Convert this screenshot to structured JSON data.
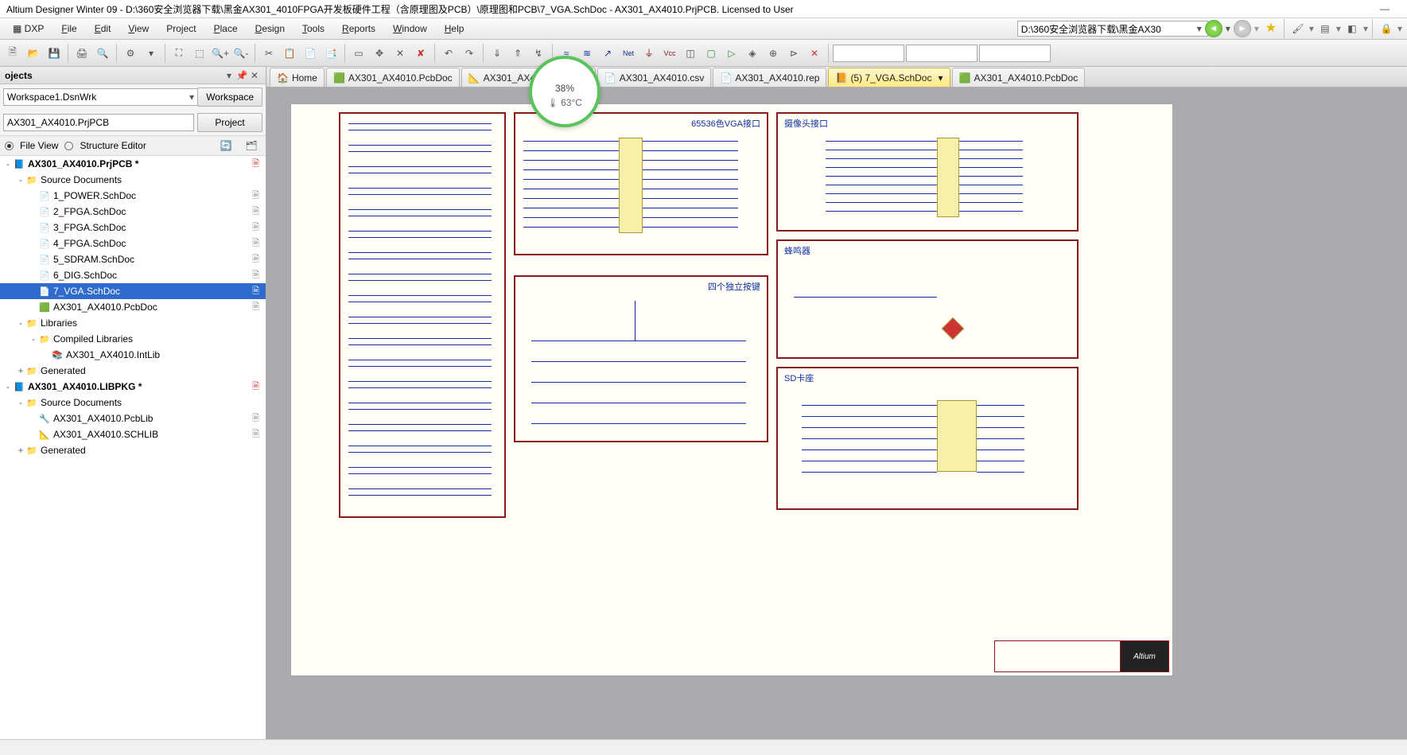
{
  "title": "Altium Designer Winter 09 - D:\\360安全浏览器下载\\黑金AX301_4010FPGA开发板硬件工程（含原理图及PCB）\\原理图和PCB\\7_VGA.SchDoc - AX301_AX4010.PrjPCB. Licensed to User",
  "menu": {
    "dxp": "DXP",
    "file": "File",
    "edit": "Edit",
    "view": "View",
    "project": "Project",
    "place": "Place",
    "design": "Design",
    "tools": "Tools",
    "reports": "Reports",
    "window": "Window",
    "help": "Help"
  },
  "address": "D:\\360安全浏览器下载\\黑金AX30",
  "overlay": {
    "pct": "38",
    "unit": "%",
    "temp": "63°C"
  },
  "panel": {
    "title": "ojects",
    "workspace": "Workspace1.DsnWrk",
    "workspace_btn": "Workspace",
    "project": "AX301_AX4010.PrjPCB",
    "project_btn": "Project",
    "file_view": "File View",
    "structure_editor": "Structure Editor"
  },
  "tree": [
    {
      "d": 0,
      "exp": "-",
      "type": "prj",
      "label": "AX301_AX4010.PrjPCB *",
      "mark": "📄",
      "sel": false,
      "bold": true,
      "markcolor": "#d33"
    },
    {
      "d": 1,
      "exp": "-",
      "type": "folder",
      "label": "Source Documents"
    },
    {
      "d": 2,
      "exp": "",
      "type": "sch",
      "label": "1_POWER.SchDoc",
      "mark": "📄"
    },
    {
      "d": 2,
      "exp": "",
      "type": "sch",
      "label": "2_FPGA.SchDoc",
      "mark": "📄"
    },
    {
      "d": 2,
      "exp": "",
      "type": "sch",
      "label": "3_FPGA.SchDoc",
      "mark": "📄"
    },
    {
      "d": 2,
      "exp": "",
      "type": "sch",
      "label": "4_FPGA.SchDoc",
      "mark": "📄"
    },
    {
      "d": 2,
      "exp": "",
      "type": "sch",
      "label": "5_SDRAM.SchDoc",
      "mark": "📄"
    },
    {
      "d": 2,
      "exp": "",
      "type": "sch",
      "label": "6_DIG.SchDoc",
      "mark": "📄"
    },
    {
      "d": 2,
      "exp": "",
      "type": "sch",
      "label": "7_VGA.SchDoc",
      "mark": "📄",
      "sel": true
    },
    {
      "d": 2,
      "exp": "",
      "type": "pcb",
      "label": "AX301_AX4010.PcbDoc",
      "mark": "📄"
    },
    {
      "d": 1,
      "exp": "-",
      "type": "folder",
      "label": "Libraries"
    },
    {
      "d": 2,
      "exp": "-",
      "type": "folder",
      "label": "Compiled Libraries"
    },
    {
      "d": 3,
      "exp": "",
      "type": "lib",
      "label": "AX301_AX4010.IntLib"
    },
    {
      "d": 1,
      "exp": "+",
      "type": "folder",
      "label": "Generated"
    },
    {
      "d": 0,
      "exp": "-",
      "type": "prj",
      "label": "AX301_AX4010.LIBPKG *",
      "mark": "📄",
      "bold": true,
      "markcolor": "#d33"
    },
    {
      "d": 1,
      "exp": "-",
      "type": "folder",
      "label": "Source Documents"
    },
    {
      "d": 2,
      "exp": "",
      "type": "pcblib",
      "label": "AX301_AX4010.PcbLib",
      "mark": "📄"
    },
    {
      "d": 2,
      "exp": "",
      "type": "schlib",
      "label": "AX301_AX4010.SCHLIB",
      "mark": "📄"
    },
    {
      "d": 1,
      "exp": "+",
      "type": "folder",
      "label": "Generated"
    }
  ],
  "tabs": [
    {
      "label": "Home",
      "icon": "home"
    },
    {
      "label": "AX301_AX4010.PcbDoc",
      "icon": "pcb"
    },
    {
      "label": "AX301_AX4010.SCHLIB",
      "icon": "schlib"
    },
    {
      "label": "AX301_AX4010.csv",
      "icon": "doc"
    },
    {
      "label": "AX301_AX4010.rep",
      "icon": "doc"
    },
    {
      "label": "(5) 7_VGA.SchDoc",
      "icon": "sch",
      "active": true
    },
    {
      "label": "AX301_AX4010.PcbDoc",
      "icon": "pcb"
    }
  ],
  "blocks": {
    "vga": "65536色VGA接口",
    "camera": "摄像头接口",
    "buzzer": "蜂鸣器",
    "keys": "四个独立按键",
    "sd": "SD卡座"
  },
  "titleblock_logo": "Altium"
}
